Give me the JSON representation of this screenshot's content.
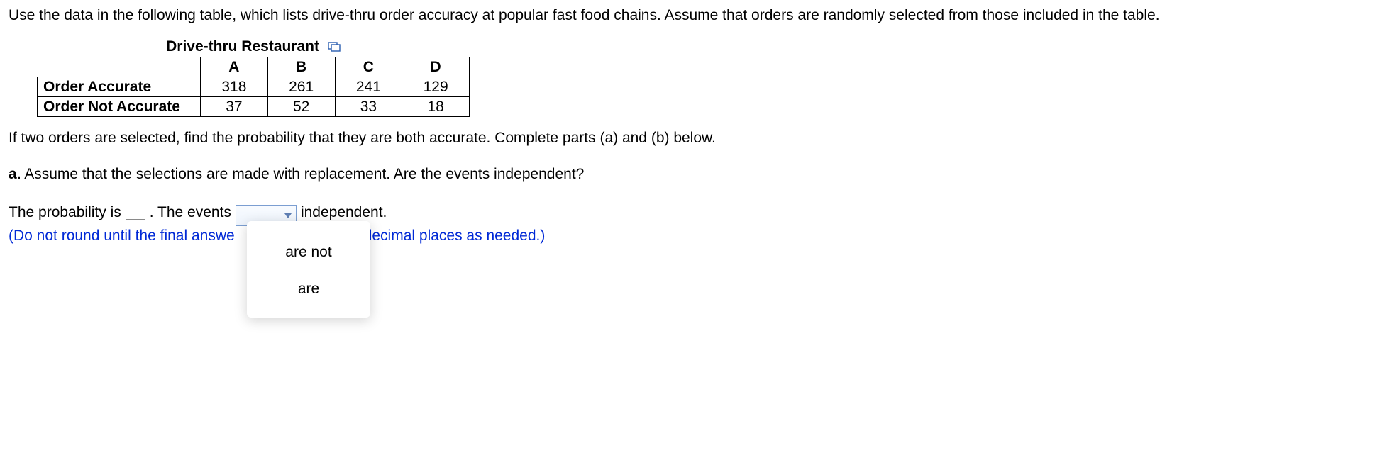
{
  "intro": "Use the data in the following table, which lists drive-thru order accuracy at popular fast food chains. Assume that orders are randomly selected from those included in the table.",
  "table": {
    "title": "Drive-thru Restaurant",
    "headers": [
      "A",
      "B",
      "C",
      "D"
    ],
    "rows": [
      {
        "label": "Order Accurate",
        "values": [
          "318",
          "261",
          "241",
          "129"
        ]
      },
      {
        "label": "Order Not Accurate",
        "values": [
          "37",
          "52",
          "33",
          "18"
        ]
      }
    ]
  },
  "question": "If two orders are selected, find the probability that they are both accurate. Complete parts (a) and (b) below.",
  "part_a": {
    "label": "a.",
    "text": "Assume that the selections are made with replacement. Are the events independent?"
  },
  "answer": {
    "prefix": "The probability is",
    "after_box": ". The events",
    "suffix": "independent.",
    "hint_left": "(Do not round until the final answe",
    "hint_right": "decimal places as needed.)"
  },
  "dropdown": {
    "options": [
      "are not",
      "are"
    ]
  },
  "chart_data": {
    "type": "table",
    "title": "Drive-thru Restaurant",
    "columns": [
      "",
      "A",
      "B",
      "C",
      "D"
    ],
    "rows": [
      [
        "Order Accurate",
        318,
        261,
        241,
        129
      ],
      [
        "Order Not Accurate",
        37,
        52,
        33,
        18
      ]
    ]
  }
}
